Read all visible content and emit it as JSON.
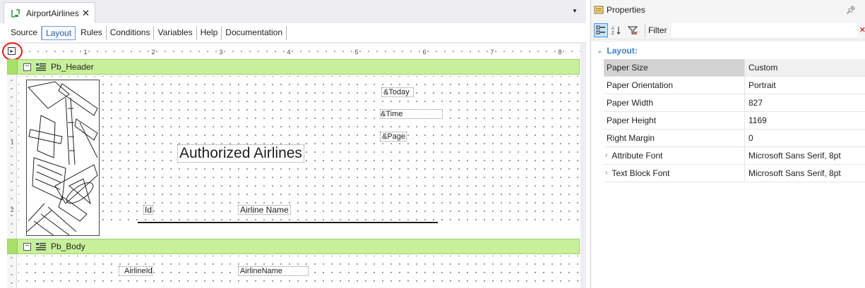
{
  "document_tab": {
    "title": "AirportAirlines",
    "close": "✕"
  },
  "subtabs": [
    "Source",
    "Layout",
    "Rules",
    "Conditions",
    "Variables",
    "Help",
    "Documentation"
  ],
  "active_subtab": "Layout",
  "ruler": {
    "marks": [
      "1",
      "2",
      "3",
      "4",
      "5",
      "6",
      "7",
      "8"
    ],
    "vmarks": [
      "1",
      "2"
    ]
  },
  "bands": {
    "header": {
      "name": "Pb_Header"
    },
    "body": {
      "name": "Pb_Body"
    }
  },
  "controls": {
    "today": "&Today",
    "time": "&Time",
    "page": "&Page",
    "title": "Authorized Airlines",
    "id_label": "Id",
    "airline_name_label": "Airline Name",
    "airline_id_attr": "AirlineId",
    "airline_name_attr": "AirlineName"
  },
  "properties": {
    "title": "Properties",
    "filter_label": "Filter",
    "filter_value": "",
    "category": "Layout:",
    "rows": [
      {
        "name": "Paper Size",
        "value": "Custom",
        "selected": true
      },
      {
        "name": "Paper Orientation",
        "value": "Portrait"
      },
      {
        "name": "Paper Width",
        "value": "827"
      },
      {
        "name": "Paper Height",
        "value": "1169"
      },
      {
        "name": "Right Margin",
        "value": "0"
      },
      {
        "name": "Attribute Font",
        "value": "Microsoft Sans Serif, 8pt",
        "expandable": true
      },
      {
        "name": "Text Block Font",
        "value": "Microsoft Sans Serif, 8pt",
        "expandable": true
      }
    ]
  },
  "colors": {
    "band": "#c8f09a",
    "accent": "#3b7fd0",
    "highlight": "#e21b1b"
  }
}
